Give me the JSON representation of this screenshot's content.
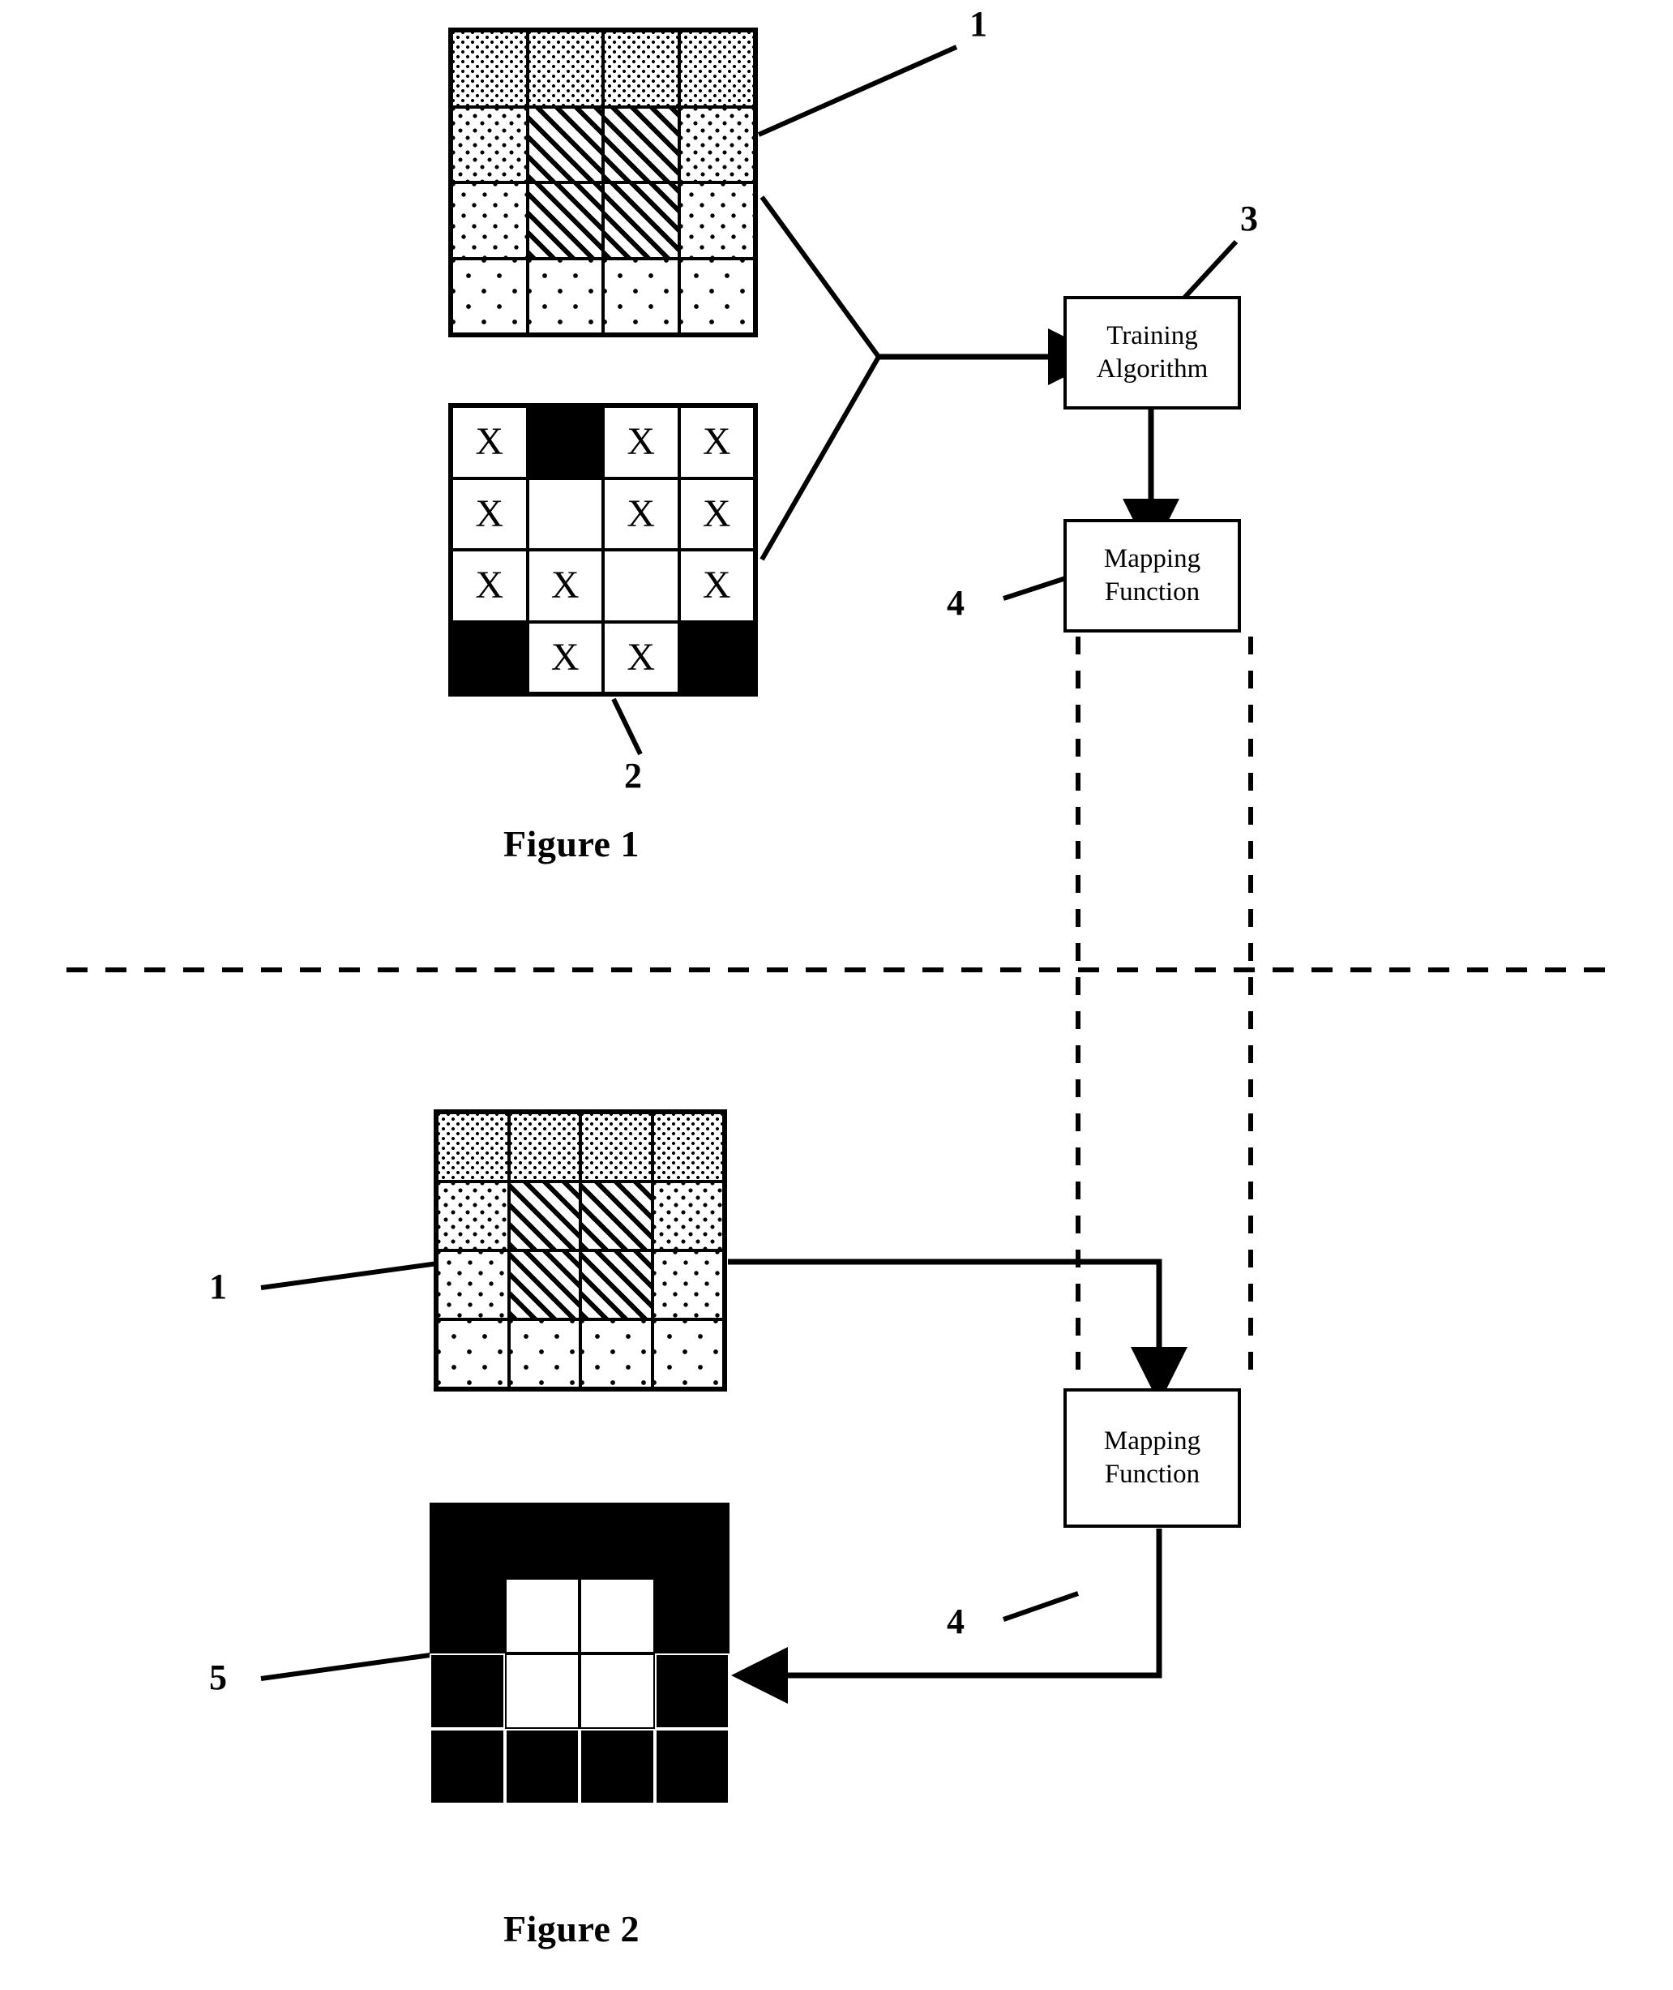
{
  "figures": [
    {
      "caption": "Figure 1",
      "reference_labels": [
        {
          "id": "1",
          "text": "1"
        },
        {
          "id": "2",
          "text": "2"
        },
        {
          "id": "3",
          "text": "3"
        },
        {
          "id": "4",
          "text": "4"
        }
      ],
      "boxes": [
        {
          "id": "training-algorithm",
          "line1": "Training",
          "line2": "Algorithm",
          "ref": "3"
        },
        {
          "id": "mapping-function",
          "line1": "Mapping",
          "line2": "Function",
          "ref": "4"
        }
      ],
      "input_grid": {
        "ref": "1",
        "rows": 4,
        "cols": 4,
        "cells": [
          [
            "dots1",
            "dots1",
            "dots1",
            "dots1"
          ],
          [
            "dots2",
            "hatch",
            "hatch",
            "dots2"
          ],
          [
            "dots3",
            "hatch",
            "hatch",
            "dots3"
          ],
          [
            "dots4",
            "dots4",
            "dots4",
            "dots4"
          ]
        ]
      },
      "label_grid": {
        "ref": "2",
        "rows": 4,
        "cols": 4,
        "cells": [
          [
            "X",
            "black",
            "X",
            "X"
          ],
          [
            "X",
            "empty",
            "X",
            "X"
          ],
          [
            "X",
            "X",
            "empty",
            "X"
          ],
          [
            "black",
            "X",
            "X",
            "black"
          ]
        ]
      }
    },
    {
      "caption": "Figure 2",
      "reference_labels": [
        {
          "id": "1",
          "text": "1"
        },
        {
          "id": "4",
          "text": "4"
        },
        {
          "id": "5",
          "text": "5"
        }
      ],
      "boxes": [
        {
          "id": "mapping-function",
          "line1": "Mapping",
          "line2": "Function",
          "ref": "4"
        }
      ],
      "input_grid": {
        "ref": "1",
        "rows": 4,
        "cols": 4,
        "cells": [
          [
            "dots1",
            "dots1",
            "dots1",
            "dots1"
          ],
          [
            "dots2",
            "hatch",
            "hatch",
            "dots2"
          ],
          [
            "dots3",
            "hatch",
            "hatch",
            "dots3"
          ],
          [
            "dots4",
            "dots4",
            "dots4",
            "dots4"
          ]
        ]
      },
      "output_grid": {
        "ref": "5",
        "rows": 4,
        "cols": 4,
        "cells": [
          [
            "black",
            "black",
            "black",
            "black"
          ],
          [
            "black",
            "white",
            "white",
            "black"
          ],
          [
            "black",
            "white",
            "white",
            "black"
          ],
          [
            "black",
            "black",
            "black",
            "black"
          ]
        ]
      }
    }
  ],
  "colors": {
    "ink": "#000000",
    "paper": "#ffffff"
  },
  "labels": {
    "fig1_caption": "Figure 1",
    "fig2_caption": "Figure 2",
    "num1_top": "1",
    "num2": "2",
    "num3": "3",
    "num4_top": "4",
    "num1_bottom": "1",
    "num4_bottom": "4",
    "num5": "5",
    "training_line1": "Training",
    "training_line2": "Algorithm",
    "mapping_line1": "Mapping",
    "mapping_line2": "Function",
    "x_mark": "X"
  }
}
